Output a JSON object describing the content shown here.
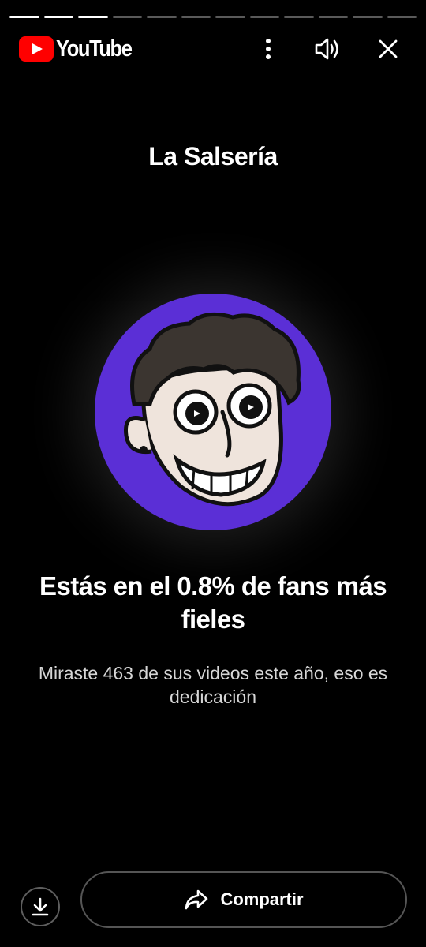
{
  "app": {
    "logo_text": "YouTube",
    "brand_color": "#FF0000"
  },
  "progress": {
    "segments_total": 12,
    "segments_viewed": 3
  },
  "header": {
    "icons": [
      "more-vert-icon",
      "volume-icon",
      "close-icon"
    ]
  },
  "channel": {
    "name": "La Salsería",
    "avatar_bg_color": "#5B2FD6"
  },
  "stat": {
    "headline": "Estás en el 0.8% de fans más fieles",
    "detail": "Miraste 463 de sus videos este año, eso es dedicación"
  },
  "footer": {
    "download_icon": "download-icon",
    "share_label": "Compartir",
    "share_icon": "share-arrow-icon"
  }
}
